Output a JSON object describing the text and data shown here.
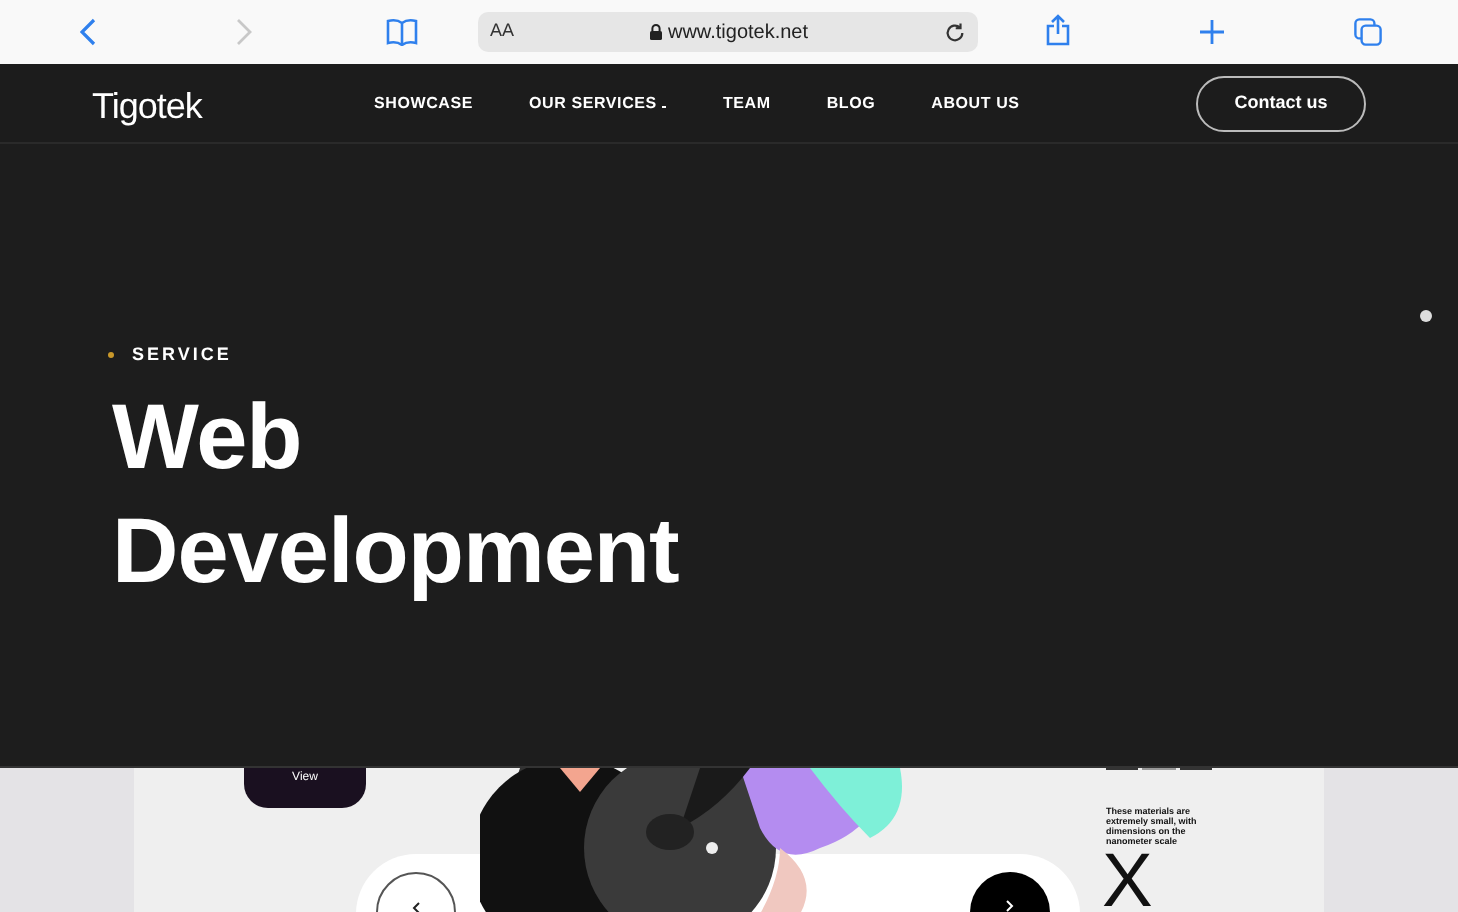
{
  "browser": {
    "text_size_label": "AA",
    "url": "www.tigotek.net"
  },
  "nav": {
    "logo": "Tigotek",
    "items": [
      {
        "label": "SHOWCASE",
        "dropdown": false
      },
      {
        "label": "OUR SERVICES",
        "dropdown": true
      },
      {
        "label": "TEAM",
        "dropdown": false
      },
      {
        "label": "BLOG",
        "dropdown": false
      },
      {
        "label": "ABOUT US",
        "dropdown": false
      }
    ],
    "cta": "Contact us"
  },
  "hero": {
    "eyebrow": "SERVICE",
    "title_lines": [
      "Web",
      "Development"
    ]
  },
  "preview": {
    "button": "View",
    "caption": "These materials are extremely small, with dimensions on the nanometer scale",
    "letter": "X"
  }
}
